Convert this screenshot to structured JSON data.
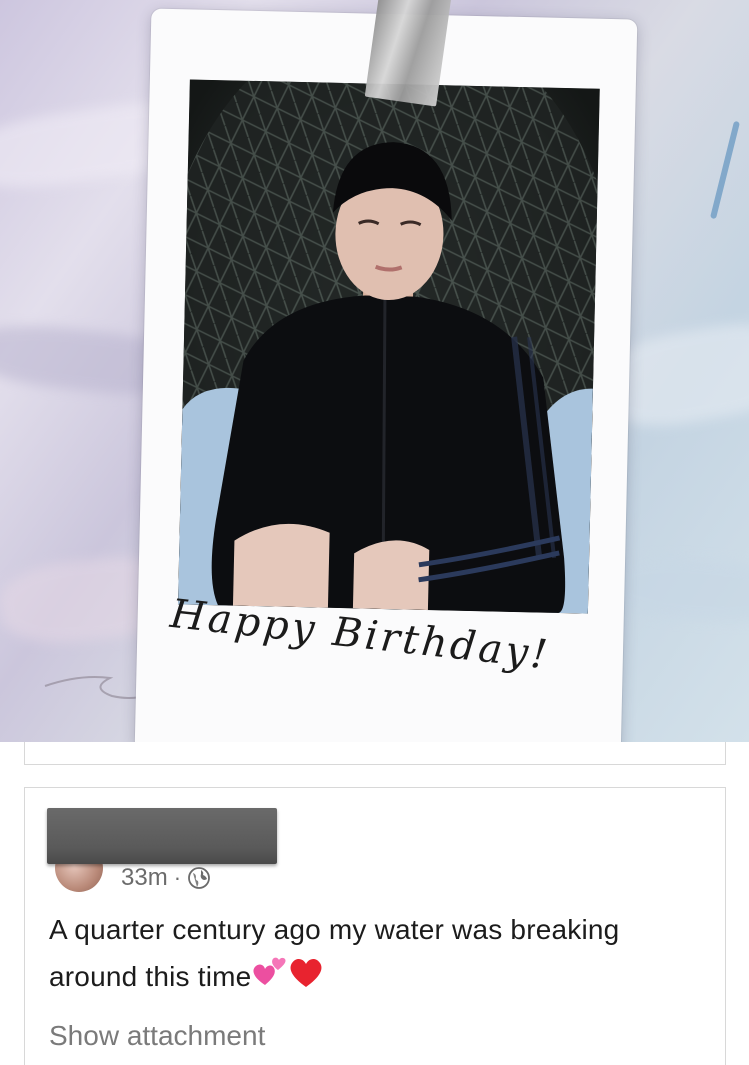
{
  "photo": {
    "caption": "Happy Birthday!",
    "description_icon": "photo-image"
  },
  "post": {
    "timestamp": "33m",
    "separator": "·",
    "privacy_icon": "globe-icon",
    "text_line1": "A quarter century ago my water was breaking",
    "text_line2": "around this time",
    "emoji": [
      "two-hearts",
      "red-heart"
    ],
    "show_attachment_label": "Show attachment"
  },
  "colors": {
    "text": "#1c1c1c",
    "meta_text": "#6b6b6b",
    "link_text": "#7a7a7a",
    "card_border": "#d8d8d8",
    "heart_red": "#e8232f",
    "heart_pink": "#ec4fa0"
  }
}
